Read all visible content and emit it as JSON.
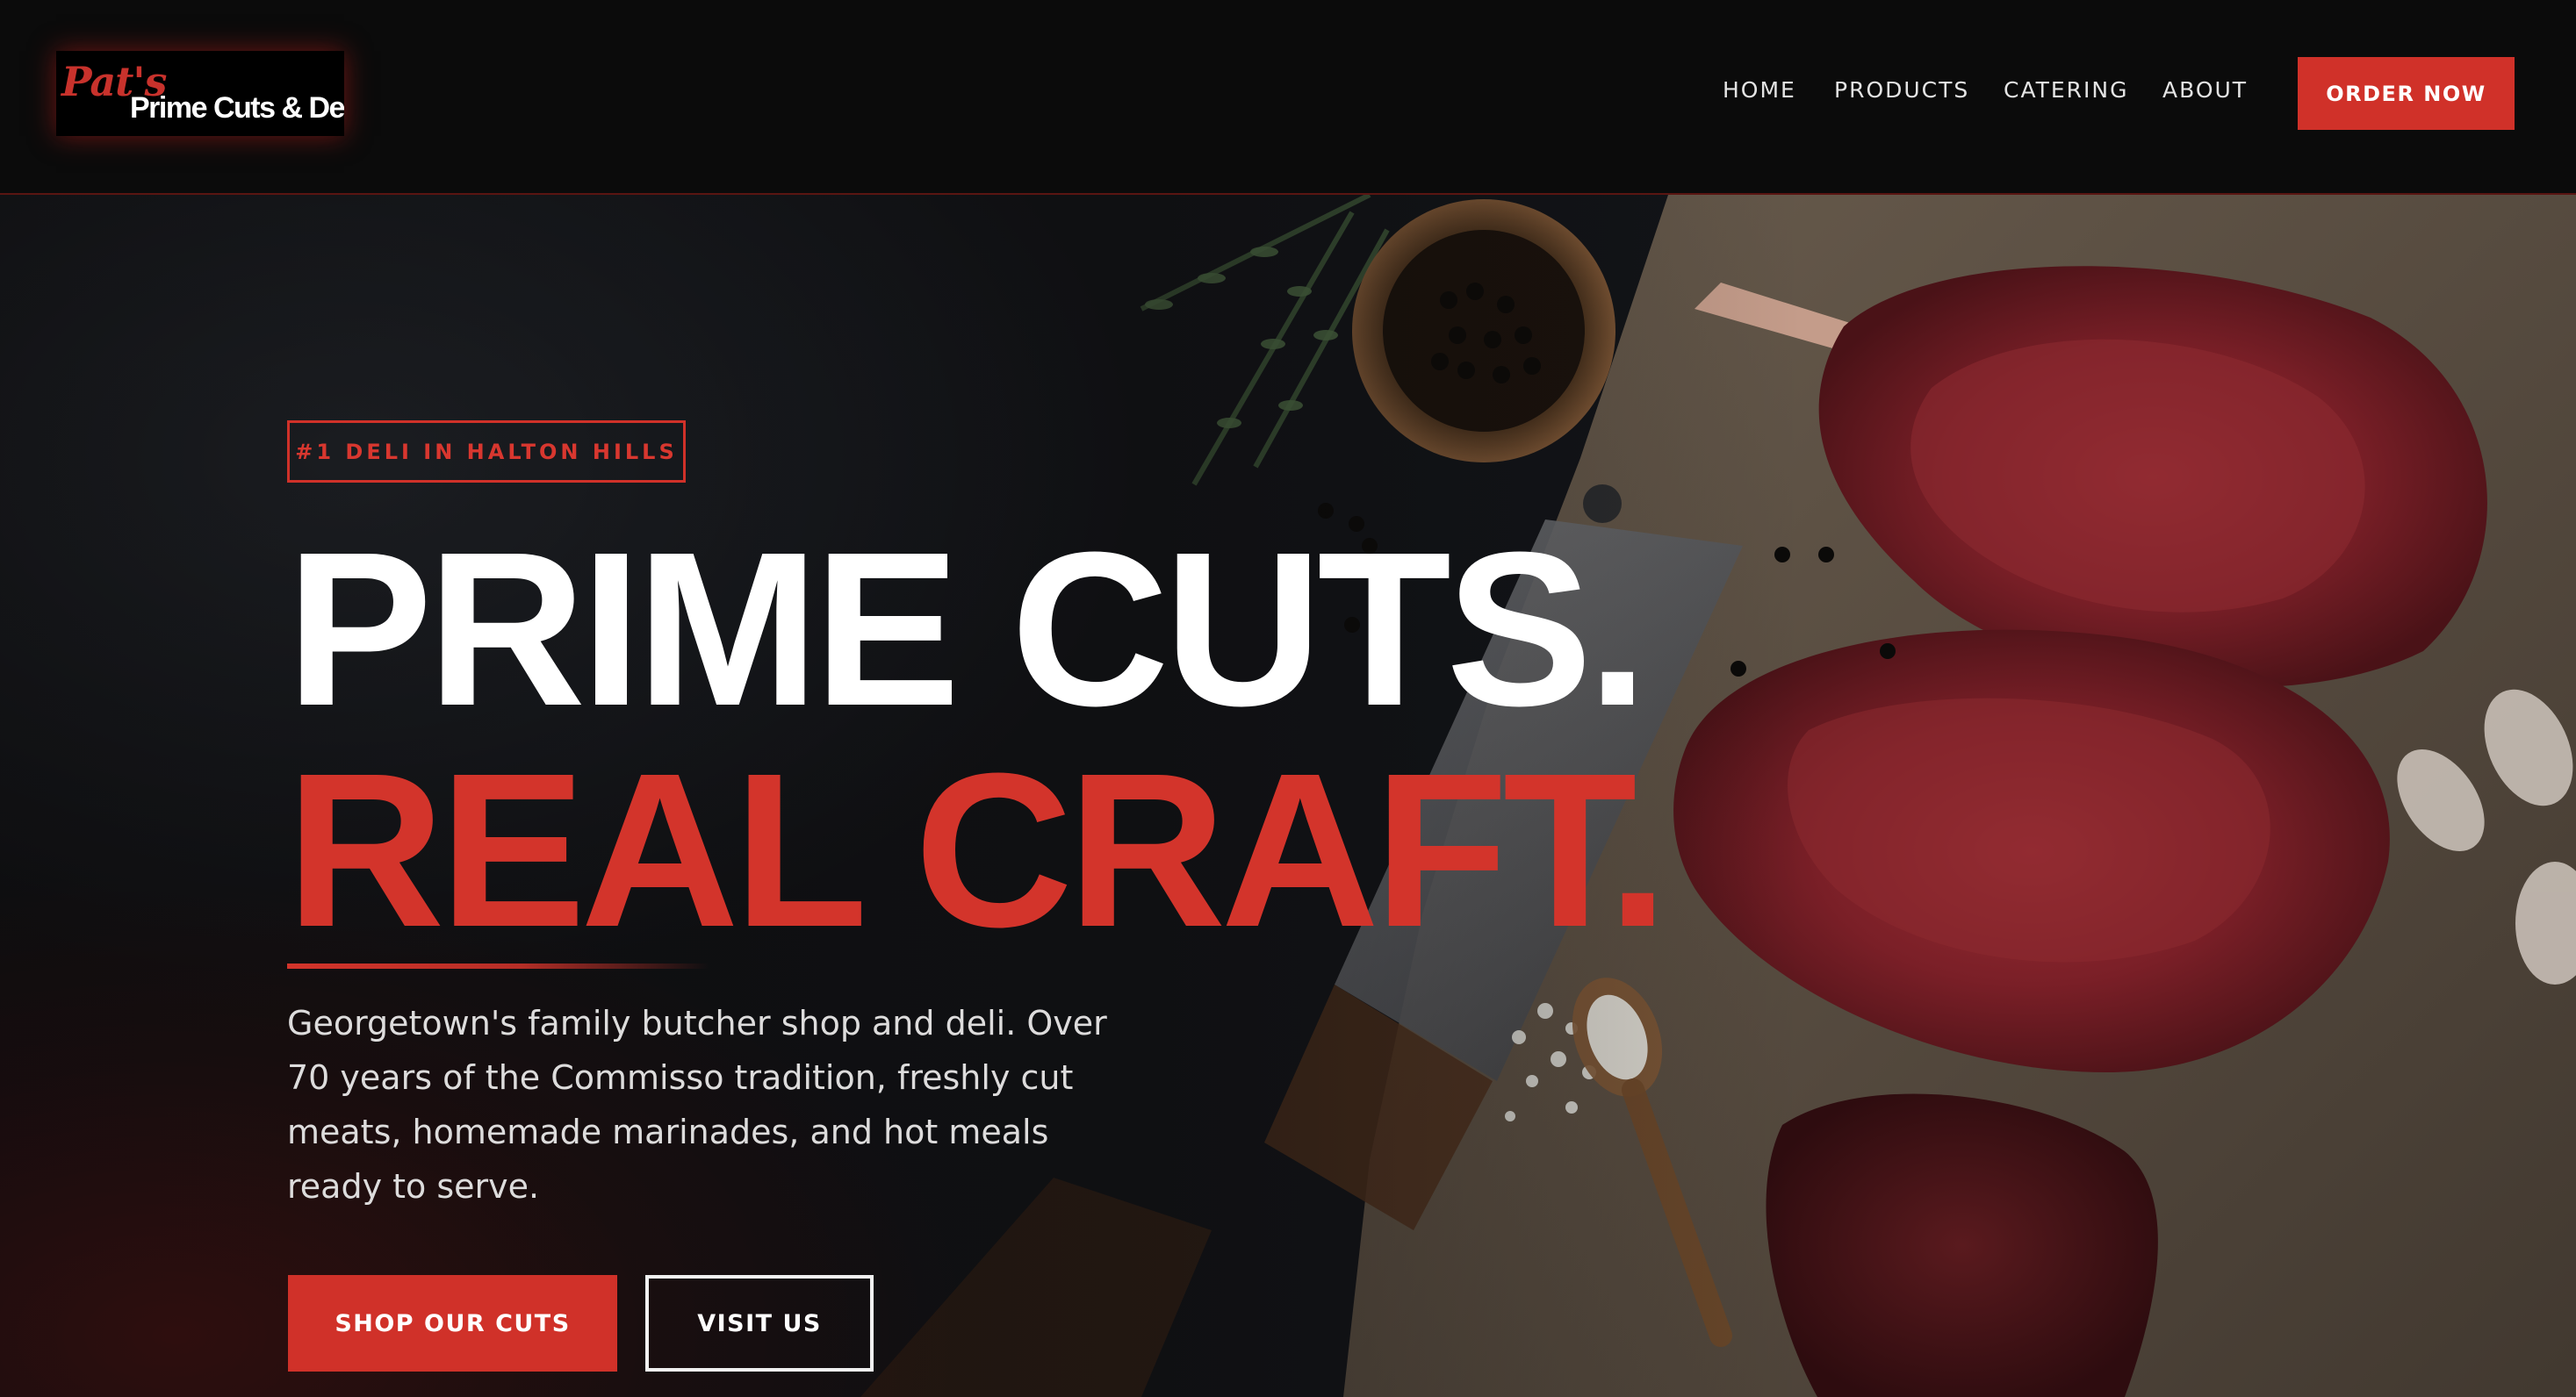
{
  "brand": {
    "logo_script": "Pat's",
    "logo_name": "Prime Cuts & Deli"
  },
  "nav": {
    "items": [
      {
        "label": "HOME"
      },
      {
        "label": "PRODUCTS"
      },
      {
        "label": "CATERING"
      },
      {
        "label": "ABOUT"
      }
    ],
    "cta_label": "ORDER NOW"
  },
  "hero": {
    "badge": "#1 DELI IN HALTON HILLS",
    "headline_line1": "PRIME CUTS.",
    "headline_line2": "REAL CRAFT.",
    "description": "Georgetown's family butcher shop and deli. Over 70 years of the Commisso tradition, freshly cut meats, homemade marinades, and hot meals ready to serve.",
    "primary_button": "SHOP OUR CUTS",
    "secondary_button": "VISIT US"
  },
  "colors": {
    "accent": "#d03129",
    "nav_background": "#0b0b0b",
    "headline_white": "#ffffff",
    "headline_red": "#d3342b"
  }
}
